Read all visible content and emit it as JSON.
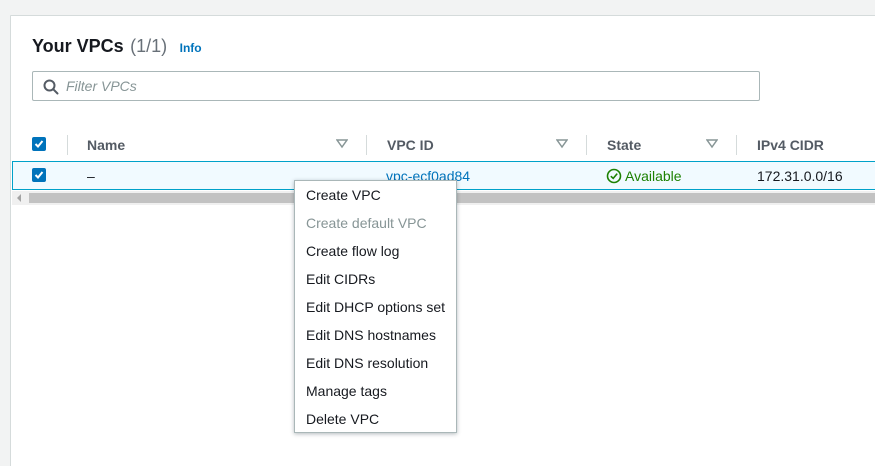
{
  "header": {
    "title": "Your VPCs",
    "count": "(1/1)",
    "info_link": "Info"
  },
  "filter": {
    "placeholder": "Filter VPCs",
    "value": ""
  },
  "table": {
    "columns": [
      "Name",
      "VPC ID",
      "State",
      "IPv4 CIDR"
    ],
    "rows": [
      {
        "selected": true,
        "name": "–",
        "vpc_id": "vpc-ecf0ad84",
        "state": "Available",
        "ipv4_cidr": "172.31.0.0/16"
      }
    ]
  },
  "context_menu": {
    "items": [
      {
        "label": "Create VPC",
        "enabled": true
      },
      {
        "label": "Create default VPC",
        "enabled": false
      },
      {
        "label": "Create flow log",
        "enabled": true
      },
      {
        "label": "Edit CIDRs",
        "enabled": true
      },
      {
        "label": "Edit DHCP options set",
        "enabled": true
      },
      {
        "label": "Edit DNS hostnames",
        "enabled": true
      },
      {
        "label": "Edit DNS resolution",
        "enabled": true
      },
      {
        "label": "Manage tags",
        "enabled": true
      },
      {
        "label": "Delete VPC",
        "enabled": true
      }
    ]
  },
  "colors": {
    "accent": "#0073bb",
    "status_available": "#1d8102",
    "selected_row_bg": "#f1faff"
  }
}
